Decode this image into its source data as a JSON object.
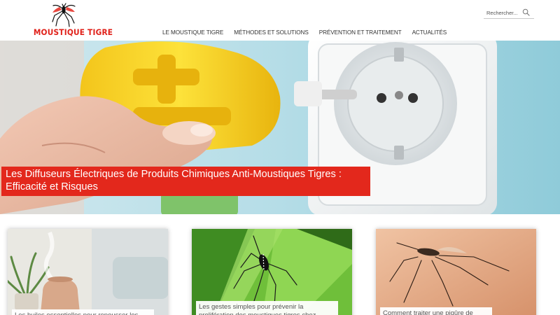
{
  "logo": {
    "text": "MOUSTIQUE TIGRE",
    "icon": "mosquito-icon",
    "color": "#e0211a"
  },
  "nav": {
    "items": [
      {
        "label": "LE MOUSTIQUE TIGRE"
      },
      {
        "label": "MÉTHODES ET SOLUTIONS"
      },
      {
        "label": "PRÉVENTION ET TRAITEMENT"
      },
      {
        "label": "ACTUALITÉS"
      }
    ]
  },
  "search": {
    "placeholder": "Rechercher...",
    "value": "",
    "icon": "search-icon"
  },
  "hero": {
    "title": "Les Diffuseurs Électriques de Produits Chimiques Anti-Moustiques Tigres : Efficacité et Risques",
    "caption_color": "#e3281c"
  },
  "cards": [
    {
      "title": "Les huiles essentielles pour repousser les"
    },
    {
      "title": "Les gestes simples pour prévenir la prolifération des moustiques tigres chez"
    },
    {
      "title": "Comment traiter une piqûre de"
    }
  ]
}
